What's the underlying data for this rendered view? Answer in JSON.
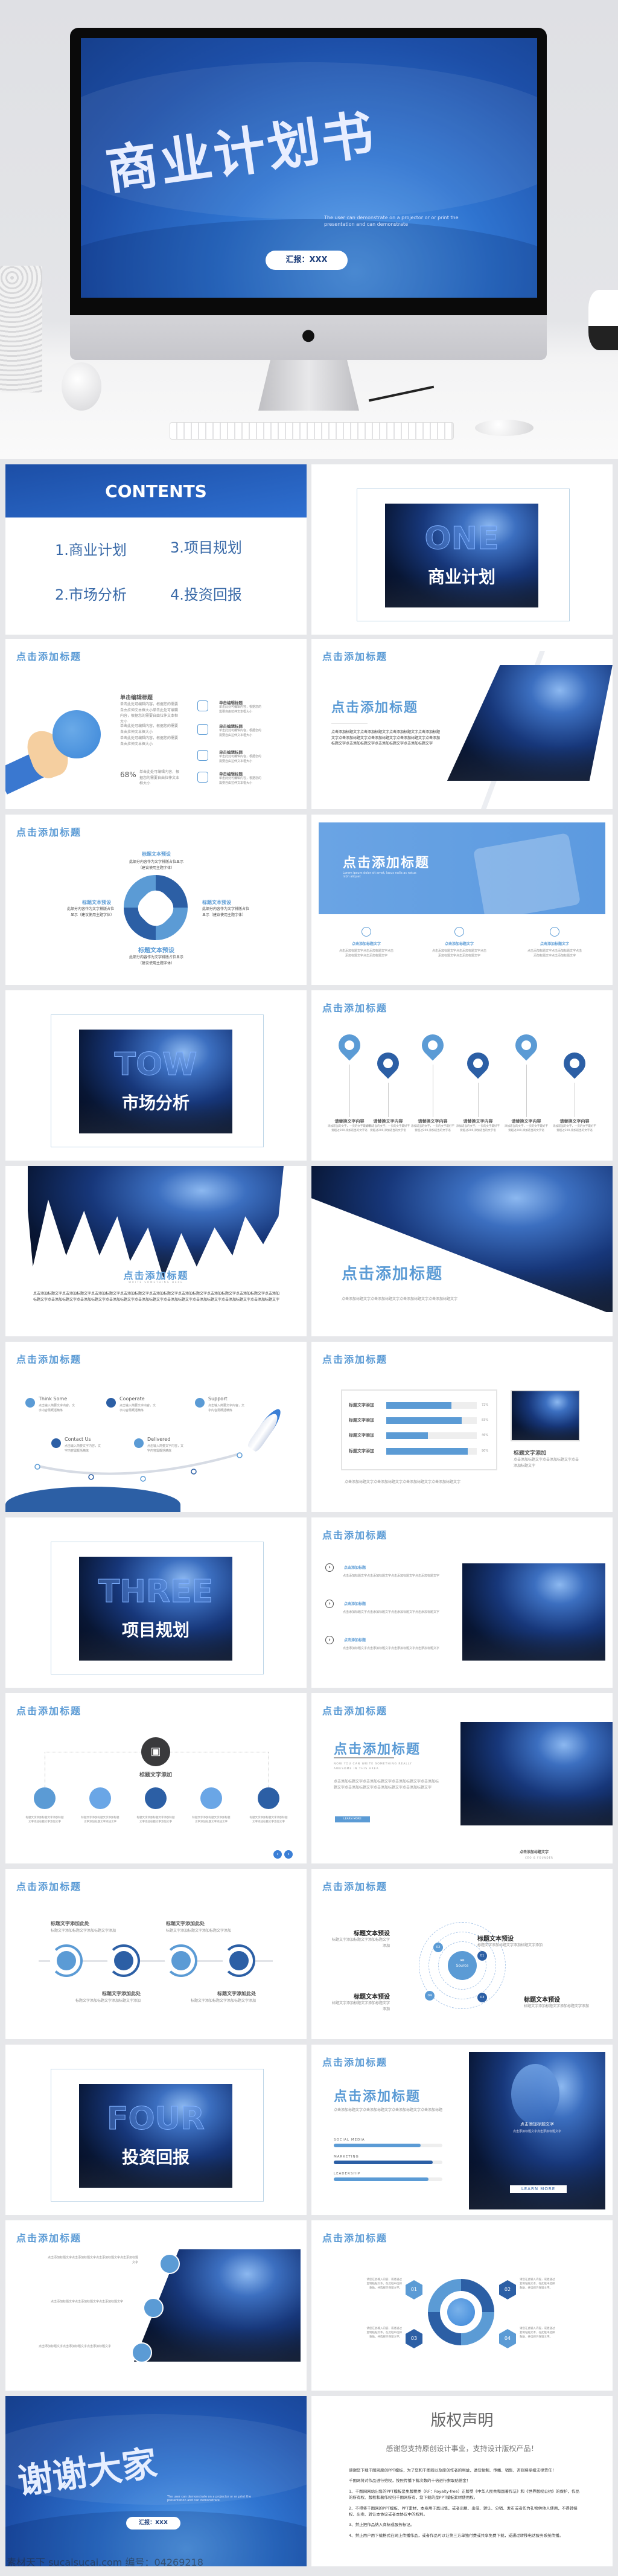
{
  "cover": {
    "title": "商业计划书",
    "subtitle": "The user can demonstrate on a projector or or print the presentation and can demonstrate",
    "reporter": "汇报：XXX",
    "icons": [
      "apple-logo-icon",
      "keyboard-icon",
      "mouse-icon"
    ]
  },
  "colors": {
    "primary": "#2c5fa5",
    "accent": "#5b9bd5",
    "light": "#e6e7ea"
  },
  "common": {
    "slide_title": "点击添加标题"
  },
  "contents": {
    "heading": "CONTENTS",
    "items": [
      "1.商业计划",
      "3.项目规划",
      "2.市场分析",
      "4.投资回报"
    ]
  },
  "sections": [
    {
      "en": "ONE",
      "cn": "商业计划"
    },
    {
      "en": "TOW",
      "cn": "市场分析"
    },
    {
      "en": "THREE",
      "cn": "项目规划"
    },
    {
      "en": "FOUR",
      "cn": "投资回报"
    }
  ],
  "globe_slide": {
    "heading": "单击编辑标题",
    "paras": [
      "单击此处可编辑内容，根据您的需要自由拉伸文本框大小单击此处可编辑内容，根据您的需要自由拉伸文本框大小",
      "单击此处可编辑内容，根据您的需要自由拉伸文本框大小",
      "单击此处可编辑内容，根据您的需要自由拉伸文本框大小"
    ],
    "percent": "68%",
    "percent_text": "单击此处可编辑内容，根据您的需要自由拉伸文本框大小",
    "items": [
      {
        "icon": "tools-icon",
        "title": "单击编辑标题",
        "text": "单击此处可编辑内容，根据您的需要自由拉伸文本框大小"
      },
      {
        "icon": "key-icon",
        "title": "单击编辑标题",
        "text": "单击此处可编辑内容，根据您的需要自由拉伸文本框大小"
      },
      {
        "icon": "lamp-icon",
        "title": "单击编辑标题",
        "text": "单击此处可编辑内容，根据您的需要自由拉伸文本框大小"
      },
      {
        "icon": "faucet-icon",
        "title": "单击编辑标题",
        "text": "单击此处可编辑内容，根据您的需要自由拉伸文本框大小"
      }
    ]
  },
  "slant_slide": {
    "title": "点击添加标题",
    "text": "点击添加标题文字点击添加标题文字点击添加标题文字点击添加标题文字点击添加标题文字点击添加标题文字点击添加标题文字点击添加标题文字点击添加标题文字点击添加标题文字点击添加标题文字"
  },
  "cycle_slide": {
    "labels": [
      {
        "title": "标题文本预设",
        "text": "此部分内容作为文字排版占位显示（建议使用主题字体）"
      },
      {
        "title": "标题文本预设",
        "text": "此部分内容作为文字排版占位显示（建议使用主题字体）"
      },
      {
        "title": "标题文本预设",
        "text": "此部分内容作为文字排版占位显示（建议使用主题字体）"
      },
      {
        "title": "标题文本预设",
        "text": "此部分内容作为文字排版占位显示（建议使用主题字体）"
      }
    ]
  },
  "banner_slide": {
    "title": "点击添加标题",
    "lorem": "Lorem ipsum dolor sit amet, lacus nulla ac netus nibh aliquet",
    "cols": [
      {
        "icon": "globe-icon",
        "title": "点击添加标题文字",
        "text": "点击添加标题文字点击添加标题文字点击添加标题文字点击添加标题文字"
      },
      {
        "icon": "basket-icon",
        "title": "点击添加标题文字",
        "text": "点击添加标题文字点击添加标题文字点击添加标题文字点击添加标题文字"
      },
      {
        "icon": "refresh-icon",
        "title": "点击添加标题文字",
        "text": "点击添加标题文字点击添加标题文字点击添加标题文字点击添加标题文字"
      }
    ]
  },
  "pins_slide": {
    "items": [
      {
        "title": "请替换文字内容",
        "text": "添加适当的文字，一页的文字最好不要超过200,添加适当的文字语"
      },
      {
        "title": "请替换文字内容",
        "text": "添加适当的文字，一页的文字最好不要超过200,添加适当的文字语"
      },
      {
        "title": "请替换文字内容",
        "text": "添加适当的文字，一页的文字最好不要超过200,添加适当的文字语"
      },
      {
        "title": "请替换文字内容",
        "text": "添加适当的文字，一页的文字最好不要超过200,添加适当的文字语"
      },
      {
        "title": "请替换文字内容",
        "text": "添加适当的文字，一页的文字最好不要超过200,添加适当的文字语"
      },
      {
        "title": "请替换文字内容",
        "text": "添加适当的文字，一页的文字最好不要超过200,添加适当的文字语"
      }
    ]
  },
  "brush_slide": {
    "title": "点击添加标题",
    "sub": "WRITE SOMETHING HERE",
    "text": "点击添加标题文字点击添加标题文字点击添加标题文字点击添加标题文字点击添加标题文字点击添加标题文字点击添加标题文字点击添加标题文字点击添加标题文字点击添加标题文字点击添加标题文字点击添加标题文字点击添加标题文字点击添加标题文字点击添加标题文字点击添加标题文字点击添加标题文字"
  },
  "diag_slide": {
    "title": "点击添加标题",
    "text": "点击添加标题文字点击添加标题文字点击添加标题文字点击添加标题文字"
  },
  "rocket_slide": {
    "items": [
      {
        "icon": "chat-bubble-icon",
        "title": "Think Some",
        "text": "点击输入简要文字内容，文字内容需概括精炼"
      },
      {
        "icon": "handshake-icon",
        "title": "Cooperate",
        "text": "点击输入简要文字内容，文字内容需概括精炼"
      },
      {
        "icon": "support-24-icon",
        "title": "Support",
        "text": "点击输入简要文字内容，文字内容需概括精炼"
      },
      {
        "icon": "mail-icon",
        "title": "Contact Us",
        "text": "点击输入简要文字内容，文字内容需概括精炼"
      },
      {
        "icon": "truck-icon",
        "title": "Delivered",
        "text": "点击输入简要文字内容，文字内容需概括精炼"
      }
    ]
  },
  "bars_slide": {
    "rows": [
      {
        "label": "标题文字添加",
        "value": 72,
        "text": "72%"
      },
      {
        "label": "标题文字添加",
        "value": 83,
        "text": "83%"
      },
      {
        "label": "标题文字添加",
        "value": 46,
        "text": "46%"
      },
      {
        "label": "标题文字添加",
        "value": 90,
        "text": "90%"
      }
    ],
    "caption": "标题文字添加",
    "caption_text": "点击添加标题文字点击添加标题文字点击添加标题文字",
    "bottom_text": "点击添加标题文字点击添加标题文字点击添加标题文字点击添加标题文字"
  },
  "list_slide": {
    "items": [
      {
        "title": "点击添加标题",
        "text": "点击添加标题文字点击添加标题文字点击添加标题文字点击添加标题文字"
      },
      {
        "title": "点击添加标题",
        "text": "点击添加标题文字点击添加标题文字点击添加标题文字点击添加标题文字"
      },
      {
        "title": "点击添加标题",
        "text": "点击添加标题文字点击添加标题文字点击添加标题文字点击添加标题文字"
      }
    ]
  },
  "tree_slide": {
    "center": "标题文字添加",
    "nodes": [
      {
        "icon": "org-chart-icon",
        "text": "标题文字添加标题文字添加标题文字添加标题文字添加文字"
      },
      {
        "icon": "heart-icon",
        "text": "标题文字添加标题文字添加标题文字添加标题文字添加文字"
      },
      {
        "icon": "clock-dollar-icon",
        "text": "标题文字添加标题文字添加标题文字添加标题文字添加文字"
      },
      {
        "icon": "mail-icon",
        "text": "标题文字添加标题文字添加标题文字添加标题文字添加文字"
      },
      {
        "icon": "trophy-icon",
        "text": "标题文字添加标题文字添加标题文字添加标题文字添加文字"
      }
    ]
  },
  "learn_slide": {
    "title": "点击添加标题",
    "sub": "NOW YOU CAN WRITE SOMETHING REALLY AWESOME IN THIS AREA",
    "text": "点击添加标题文字点击添加标题文字点击添加标题文字点击添加标题文字点击添加标题文字点击添加标题文字点击添加标题文字",
    "button": "LEARN MORE",
    "caption": "点击添加标题文字",
    "role": "CEO & FOUNDER"
  },
  "rings_slide": {
    "labels": [
      {
        "title": "标题文字添加此处",
        "text": "标题文字添加标题文字添加标题文字添加"
      },
      {
        "title": "标题文字添加此处",
        "text": "标题文字添加标题文字添加标题文字添加"
      },
      {
        "title": "标题文字添加此处",
        "text": "标题文字添加标题文字添加标题文字添加"
      },
      {
        "title": "标题文字添加此处",
        "text": "标题文字添加标题文字添加标题文字添加"
      }
    ]
  },
  "source_slide": {
    "center": "Source",
    "nodes": [
      "01",
      "02",
      "03",
      "04"
    ],
    "labels": [
      {
        "title": "标题文本预设",
        "text": "标题文字添加标题文字添加标题文字添加"
      },
      {
        "title": "标题文本预设",
        "text": "标题文字添加标题文字添加标题文字添加"
      },
      {
        "title": "标题文本预设",
        "text": "标题文字添加标题文字添加标题文字添加"
      },
      {
        "title": "标题文本预设",
        "text": "标题文字添加标题文字添加标题文字添加"
      }
    ]
  },
  "skills_slide": {
    "title": "点击添加标题",
    "text": "点击添加标题文字点击添加标题文字点击添加标题文字点击添加标题",
    "bars": [
      {
        "label": "SOCIAL MEDIA",
        "value": 80
      },
      {
        "label": "MARKETING",
        "value": 91
      },
      {
        "label": "LEADERSHIP",
        "value": 87
      }
    ],
    "photo_title": "点击添加标题文字",
    "photo_text": "点击添加标题文字点击添加标题文字",
    "button": "LEARN MORE"
  },
  "icons_photo_slide": {
    "items": [
      {
        "icon": "monitor-icon",
        "text": "点击添加标题文字点击添加标题文字点击添加标题文字点击添加标题文字"
      },
      {
        "icon": "target-icon",
        "text": "点击添加标题文字点击添加标题文字点击添加标题文字"
      },
      {
        "icon": "phone-icon",
        "text": "点击添加标题文字点击添加标题文字点击添加标题文字"
      }
    ]
  },
  "hex_slide": {
    "items": [
      {
        "num": "01",
        "text": "请您在此输入内容，或者通过复制粘贴文本，在此框中选择粘贴，并选择只保留文字。"
      },
      {
        "num": "02",
        "text": "请您在此输入内容，或者通过复制粘贴文本，在此框中选择粘贴，并选择只保留文字。"
      },
      {
        "num": "03",
        "text": "请您在此输入内容，或者通过复制粘贴文本，在此框中选择粘贴，并选择只保留文字。"
      },
      {
        "num": "04",
        "text": "请您在此输入内容，或者通过复制粘贴文本，在此框中选择粘贴，并选择只保留文字。"
      }
    ]
  },
  "thanks": {
    "title": "谢谢大家",
    "subtitle": "The user can demonstrate on a projector or or print the presentation and can demonstrate",
    "reporter": "汇报：XXX",
    "watermark": "素材天下 sucaisucai.com 编号：04269218"
  },
  "copyright": {
    "title": "版权声明",
    "thanks": "感谢您支持原创设计事业，支持设计版权产品！",
    "paras": [
      "感谢您下载千图网原创PPT模板，为了您和千图网以及原创作者的利益，请勿复制、传播、销售，否则将承担法律责任！",
      "千图网将对作品进行维权，按照传播下载次数的十倍进行索取赔偿金！",
      "1、千图网网站出售的PPT模板是免版税类（RF：Royalty-free）正版受《中华人民共和国著作法》和《世界版权公约》的保护，作品的所有权、版权和著作权归千图网所有，您下载的是PPT模板素材使用权。",
      "2、不得将千图网的PPT模板、PPT素材，本身用于再出售，或者出租、出借、转让、分销、发布或者作为礼物供他人使用，不得转授权、出卖、转让本协议或者本协议中的权利。",
      "3、禁止把作品纳入商标或服务标记。",
      "4、禁止用户用下载格式在网上传播作品，或者作品可以让第三方单独付费或共享免费下载，或通过转移电话服务系统传播。"
    ]
  }
}
